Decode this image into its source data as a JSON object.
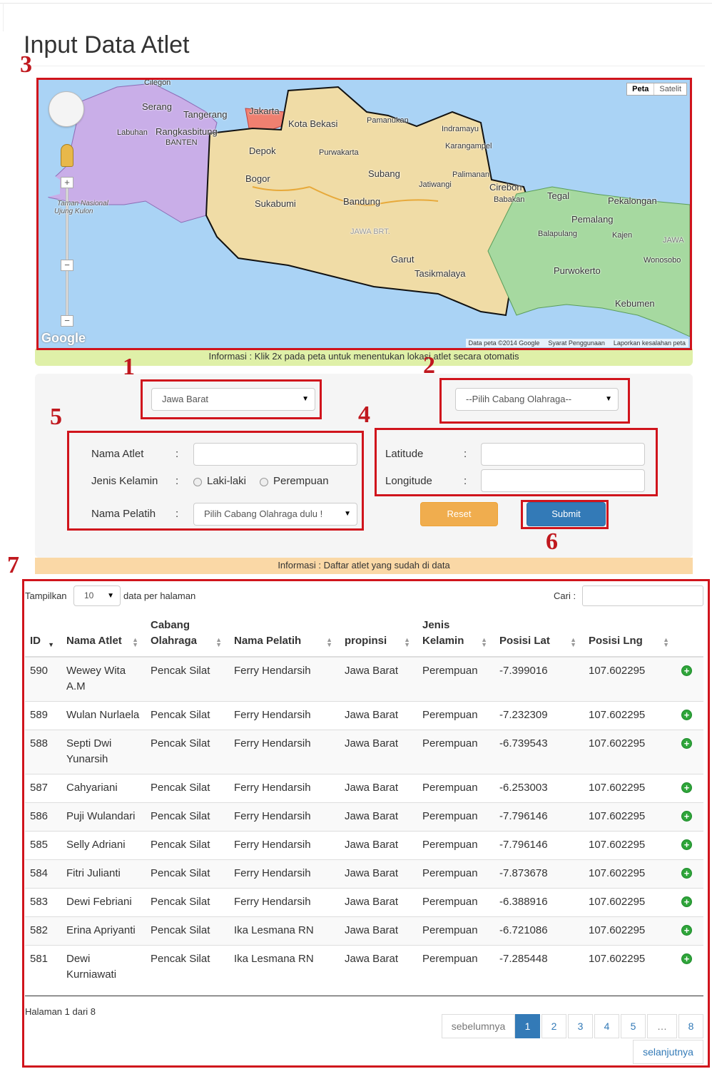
{
  "page": {
    "title": "Input Data Atlet"
  },
  "annotations": [
    "1",
    "2",
    "3",
    "4",
    "5",
    "6",
    "7"
  ],
  "map": {
    "type_buttons": [
      "Peta",
      "Satelit"
    ],
    "labels": [
      "Cilegon",
      "Serang",
      "Tangerang",
      "Jakarta",
      "Kota Bekasi",
      "Pamanukan",
      "Indramayu",
      "Labuhan",
      "Rangkasbitung",
      "BANTEN",
      "Depok",
      "Purwakarta",
      "Karangampel",
      "Bogor",
      "Subang",
      "Palimanan",
      "Cirebon",
      "Jatiwangi",
      "Babakan",
      "Tegal",
      "Pekalongan",
      "Taman Nasional",
      "Ujung Kulon",
      "Sukabumi",
      "Bandung",
      "Pemalang",
      "JAWA BRT.",
      "Balapulang",
      "Kajen",
      "JAWA",
      "Wonosobo",
      "Garut",
      "Purwokerto",
      "Tasikmalaya",
      "Kebumen"
    ],
    "logo": "Google",
    "footer": [
      "Data peta ©2014 Google",
      "Syarat Penggunaan",
      "Laporkan kesalahan peta"
    ]
  },
  "info_map": "Informasi : Klik 2x pada peta untuk menentukan lokasi atlet secara otomatis",
  "form": {
    "province_select": "Jawa Barat",
    "sport_select": "--Pilih Cabang Olahraga--",
    "nama_atlet_label": "Nama Atlet",
    "jenis_kelamin_label": "Jenis Kelamin",
    "nama_pelatih_label": "Nama Pelatih",
    "colon": ":",
    "radio_male": "Laki-laki",
    "radio_female": "Perempuan",
    "pelatih_select": "Pilih Cabang Olahraga dulu !",
    "latitude_label": "Latitude",
    "longitude_label": "Longitude",
    "reset": "Reset",
    "submit": "Submit"
  },
  "info_list": "Informasi : Daftar atlet yang sudah di data",
  "table_controls": {
    "show_label": "Tampilkan",
    "page_size": "10",
    "per_page_label": "data per halaman",
    "search_label": "Cari :"
  },
  "table": {
    "columns": [
      "ID",
      "Nama Atlet",
      "Cabang Olahraga",
      "Nama Pelatih",
      "propinsi",
      "Jenis Kelamin",
      "Posisi Lat",
      "Posisi Lng"
    ],
    "rows": [
      [
        "590",
        "Wewey Wita A.M",
        "Pencak Silat",
        "Ferry Hendarsih",
        "Jawa Barat",
        "Perempuan",
        "-7.399016",
        "107.602295"
      ],
      [
        "589",
        "Wulan Nurlaela",
        "Pencak Silat",
        "Ferry Hendarsih",
        "Jawa Barat",
        "Perempuan",
        "-7.232309",
        "107.602295"
      ],
      [
        "588",
        "Septi Dwi Yunarsih",
        "Pencak Silat",
        "Ferry Hendarsih",
        "Jawa Barat",
        "Perempuan",
        "-6.739543",
        "107.602295"
      ],
      [
        "587",
        "Cahyariani",
        "Pencak Silat",
        "Ferry Hendarsih",
        "Jawa Barat",
        "Perempuan",
        "-6.253003",
        "107.602295"
      ],
      [
        "586",
        "Puji Wulandari",
        "Pencak Silat",
        "Ferry Hendarsih",
        "Jawa Barat",
        "Perempuan",
        "-7.796146",
        "107.602295"
      ],
      [
        "585",
        "Selly Adriani",
        "Pencak Silat",
        "Ferry Hendarsih",
        "Jawa Barat",
        "Perempuan",
        "-7.796146",
        "107.602295"
      ],
      [
        "584",
        "Fitri Julianti",
        "Pencak Silat",
        "Ferry Hendarsih",
        "Jawa Barat",
        "Perempuan",
        "-7.873678",
        "107.602295"
      ],
      [
        "583",
        "Dewi Febriani",
        "Pencak Silat",
        "Ferry Hendarsih",
        "Jawa Barat",
        "Perempuan",
        "-6.388916",
        "107.602295"
      ],
      [
        "582",
        "Erina Apriyanti",
        "Pencak Silat",
        "Ika Lesmana RN",
        "Jawa Barat",
        "Perempuan",
        "-6.721086",
        "107.602295"
      ],
      [
        "581",
        "Dewi Kurniawati",
        "Pencak Silat",
        "Ika Lesmana RN",
        "Jawa Barat",
        "Perempuan",
        "-7.285448",
        "107.602295"
      ]
    ]
  },
  "pagination": {
    "info": "Halaman 1 dari 8",
    "prev": "sebelumnya",
    "pages": [
      "1",
      "2",
      "3",
      "4",
      "5",
      "…",
      "8"
    ],
    "next": "selanjutnya"
  }
}
